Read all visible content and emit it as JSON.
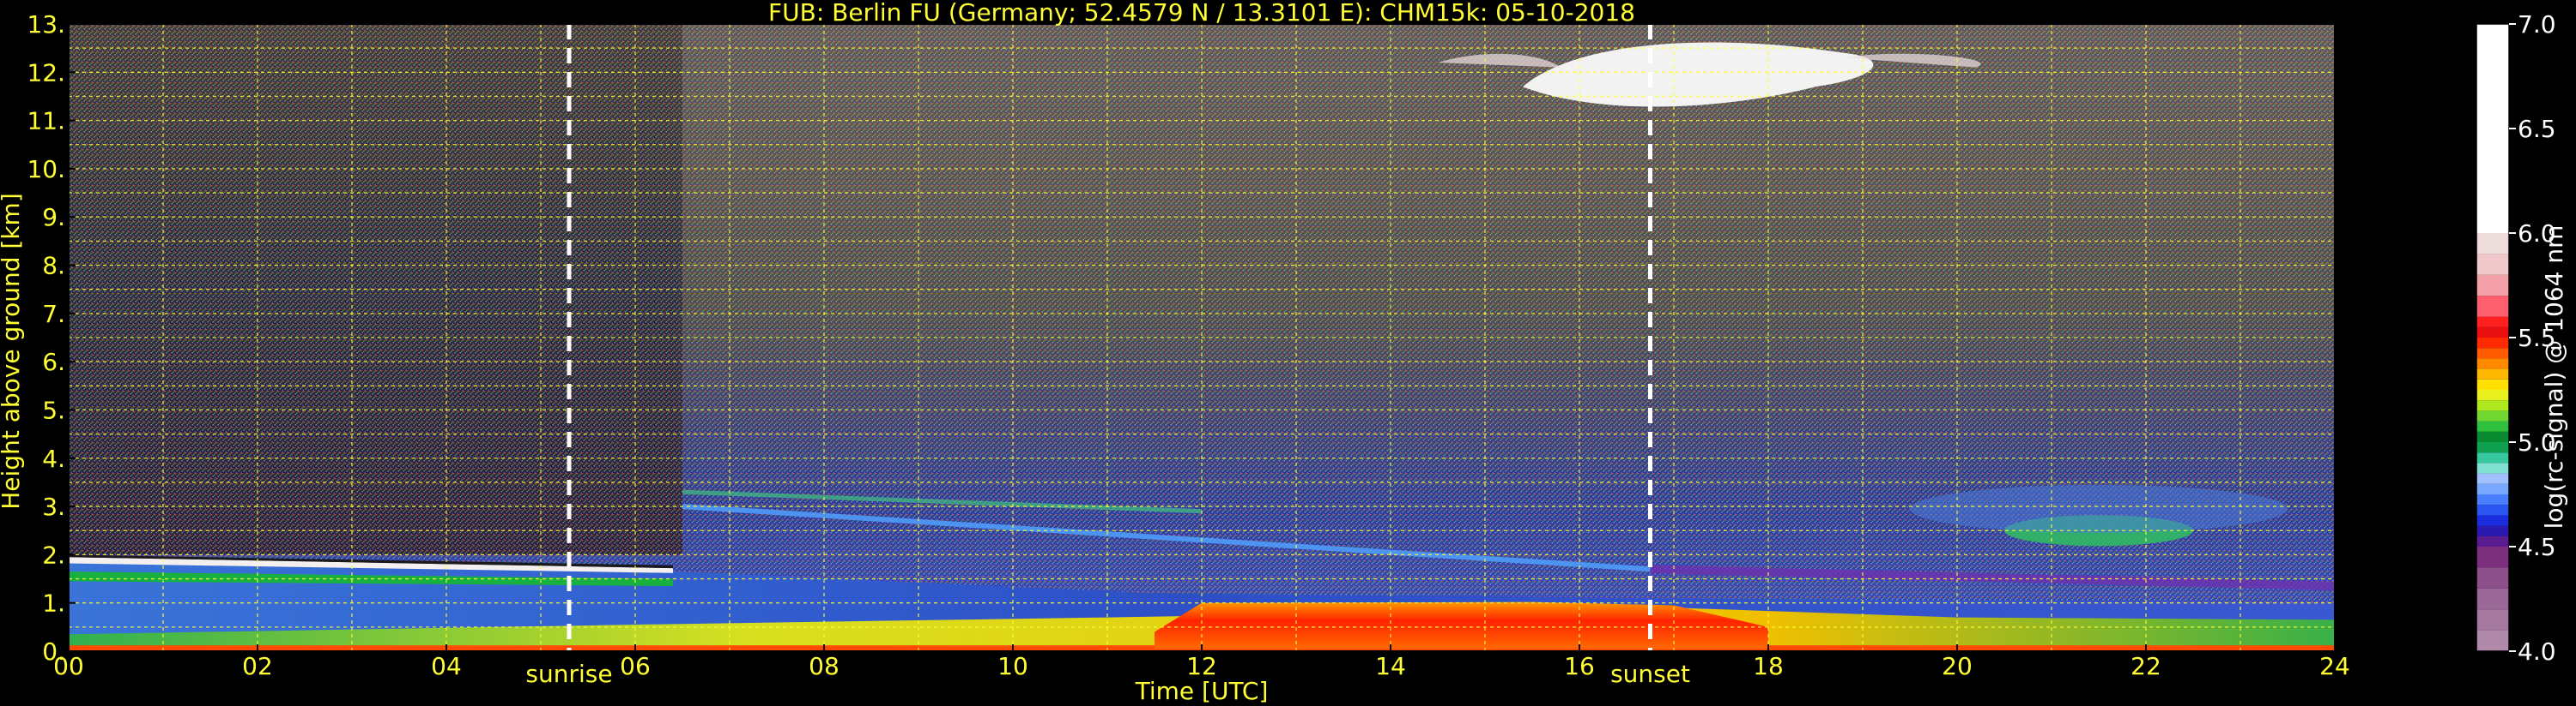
{
  "chart_data": {
    "type": "heatmap",
    "title": "FUB: Berlin FU (Germany; 52.4579 N / 13.3101 E):    CHM15k: 05-10-2018",
    "xlabel": "Time [UTC]",
    "ylabel": "Height above ground [km]",
    "xlim": [
      0,
      24
    ],
    "ylim": [
      0,
      13
    ],
    "x_ticks": [
      "00",
      "02",
      "04",
      "06",
      "08",
      "10",
      "12",
      "14",
      "16",
      "18",
      "20",
      "22",
      "24"
    ],
    "y_ticks": [
      "0.",
      "1.",
      "2.",
      "3.",
      "4.",
      "5.",
      "6.",
      "7.",
      "8.",
      "9.",
      "10.",
      "11.",
      "12.",
      "13."
    ],
    "grid": true,
    "events": [
      {
        "label": "sunrise",
        "time_utc": 5.3
      },
      {
        "label": "sunset",
        "time_utc": 16.75
      }
    ],
    "colorbar": {
      "label": "log(rc-signal) @ 1064 nm",
      "range": [
        4.0,
        7.0
      ],
      "ticks": [
        "4.0",
        "4.5",
        "5.0",
        "5.5",
        "6.0",
        "6.5",
        "7.0"
      ]
    },
    "layers": [
      {
        "feature": "boundary layer aerosol",
        "time_start": 0,
        "time_end": 24,
        "top_km_start": 1.9,
        "top_km_end": 1.0
      },
      {
        "feature": "high signal near surface",
        "time_start": 11.5,
        "time_end": 17.0,
        "top_km": 1.0,
        "log_signal": 5.6
      },
      {
        "feature": "residual layer",
        "time_start": 6.5,
        "time_end": 16.75,
        "height_km_start": 3.0,
        "height_km_end": 1.7
      },
      {
        "feature": "cirrus cloud",
        "time_start": 14.5,
        "time_end": 20.5,
        "base_km": 11.3,
        "top_km": 12.6
      },
      {
        "feature": "elevated layer",
        "time_start": 20.5,
        "time_end": 22.5,
        "height_km": 2.5
      }
    ]
  }
}
